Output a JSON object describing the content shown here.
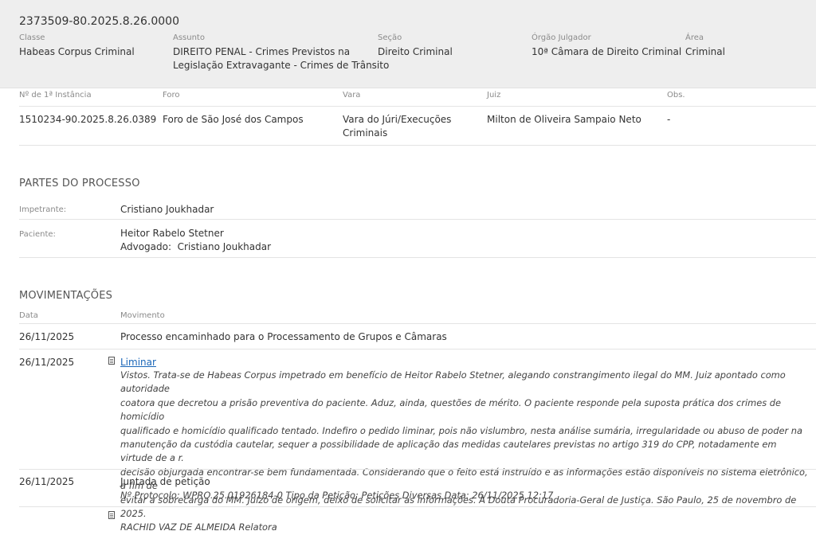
{
  "header": {
    "process_number": "2373509-80.2025.8.26.0000",
    "fields": [
      {
        "label": "Classe",
        "value": "Habeas Corpus Criminal"
      },
      {
        "label": "Assunto",
        "value": "DIREITO PENAL - Crimes Previstos na",
        "value2": "Legislação Extravagante - Crimes de Trânsito"
      },
      {
        "label": "Seção",
        "value": "Direito Criminal"
      },
      {
        "label": "Órgão Julgador",
        "value": "10ª Câmara de Direito Criminal"
      },
      {
        "label": "Área",
        "value": "Criminal"
      }
    ]
  },
  "first_instance": {
    "labels": [
      "Nº de 1ª Instância",
      "Foro",
      "Vara",
      "Juiz",
      "Obs."
    ],
    "values": {
      "number": "1510234-90.2025.8.26.0389",
      "foro": "Foro de São José dos Campos",
      "vara_line1": "Vara do Júri/Execuções",
      "vara_line2": "Criminais",
      "juiz": "Milton de Oliveira Sampaio Neto",
      "obs": "-"
    }
  },
  "parties": {
    "title": "PARTES DO PROCESSO",
    "items": [
      {
        "role": "Impetrante:",
        "name": "Cristiano Joukhadar"
      },
      {
        "role": "Paciente:",
        "name": "Heitor Rabelo Stetner",
        "extra_label": "Advogado:",
        "extra_value": "Cristiano Joukhadar"
      }
    ]
  },
  "movements": {
    "title": "MOVIMENTAÇÕES",
    "col_date": "Data",
    "col_move": "Movimento",
    "items": [
      {
        "date": "26/11/2025",
        "text": "Processo encaminhado para o Processamento de Grupos e Câmaras"
      },
      {
        "date": "26/11/2025",
        "link": "Liminar",
        "icon": "document-icon",
        "lines": [
          "Vistos. Trata-se de Habeas Corpus impetrado em benefício de Heitor Rabelo Stetner, alegando constrangimento ilegal do MM. Juiz apontado como autoridade",
          "coatora que decretou a prisão preventiva do paciente. Aduz, ainda, questões de mérito. O paciente responde pela suposta prática dos crimes de homicídio",
          "qualificado e homicídio qualificado tentado. Indefiro o pedido liminar, pois não vislumbro, nesta análise sumária, irregularidade ou abuso de poder na",
          "manutenção da custódia cautelar, sequer a possibilidade de aplicação das medidas cautelares previstas no artigo 319 do CPP, notadamente em virtude de a r.",
          "decisão objurgada encontrar-se bem fundamentada. Considerando que o feito está instruído e as informações estão disponíveis no sistema eletrônico, a fim de",
          "evitar a sobrecarga do MM. Juízo de origem, deixo de solicitar as informações. À Douta Procuradoria-Geral de Justiça. São Paulo, 25 de novembro de 2025.",
          "RACHID VAZ DE ALMEIDA Relatora"
        ]
      },
      {
        "date": "26/11/2025",
        "text": "Juntada de petição",
        "detail": "Nº Protocolo: WPRO.25.01926184-0 Tipo da Petição: Petições Diversas Data: 26/11/2025 12:17"
      }
    ]
  },
  "colors": {
    "header_bg": "#eeeeee",
    "link": "#1a66b8",
    "divider": "#e4e4e4"
  }
}
